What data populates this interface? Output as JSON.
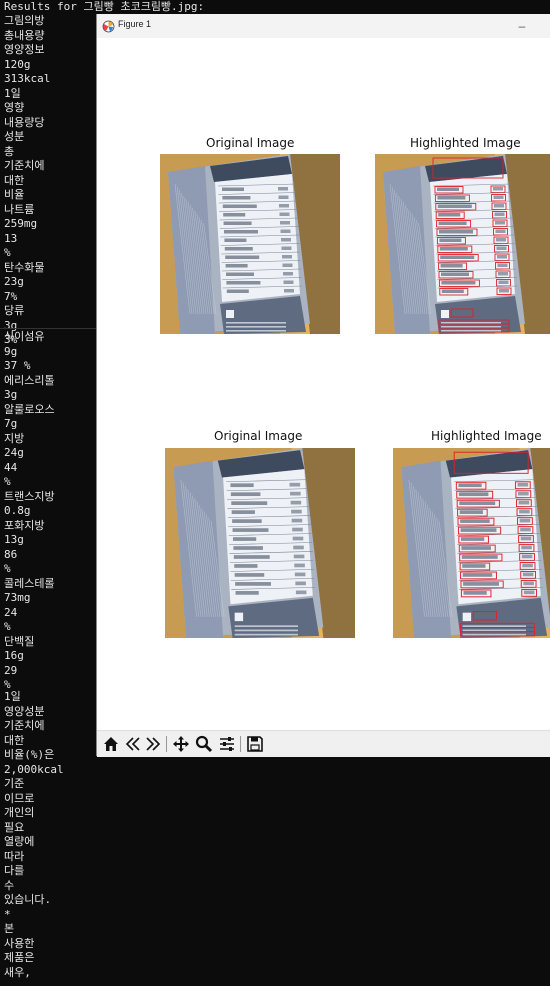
{
  "terminal": {
    "header": "Results for 그림빵 초코크림빵.jpg:",
    "column1": [
      "그림의방",
      "총내용량",
      "영양정보",
      "120g",
      "313kcal",
      "1일",
      "영향",
      "내용량당",
      "성분",
      "총",
      "기준치에",
      "대한",
      "비율",
      "나트륨",
      "259mg",
      "13",
      "%",
      "탄수화물",
      "23g",
      "7%",
      "당류",
      "3g",
      "3%"
    ],
    "column2": [
      "식이섬유",
      "9g",
      "37 %",
      "에리스리톨",
      "3g",
      "알룰로오스",
      "7g",
      "지방",
      "24g",
      "44",
      "%",
      "트랜스지방",
      "0.8g",
      "포화지방",
      "13g",
      "86",
      "%",
      "콜레스테롤",
      "73mg",
      "24",
      "%",
      "단백질",
      "16g",
      "29",
      "%"
    ],
    "column3": [
      "1일",
      "영양성분",
      "기준치에",
      "대한",
      "비율(%)은",
      "2,000kcal",
      "기준",
      "이므로",
      "개인의",
      "필요",
      "열량에",
      "따라",
      "다를",
      "수",
      "있습니다.",
      "*",
      "본",
      "사용한",
      "제품은",
      "새우,"
    ]
  },
  "window": {
    "title": "Figure 1",
    "minimize_symbol": "–"
  },
  "figure": {
    "row1": {
      "left_title": "Original Image",
      "right_title": "Highlighted Image"
    },
    "row2": {
      "left_title": "Original Image",
      "right_title": "Highlighted Image"
    }
  },
  "toolbar": {
    "icons": [
      "home-icon",
      "back-icon",
      "forward-icon",
      "pan-icon",
      "zoom-icon",
      "configure-icon",
      "save-icon"
    ]
  },
  "colors": {
    "terminal_bg": "#0c0c0c",
    "terminal_text": "#e6e6e6",
    "highlight_box": "#e0202a",
    "window_bg": "#ffffff"
  }
}
